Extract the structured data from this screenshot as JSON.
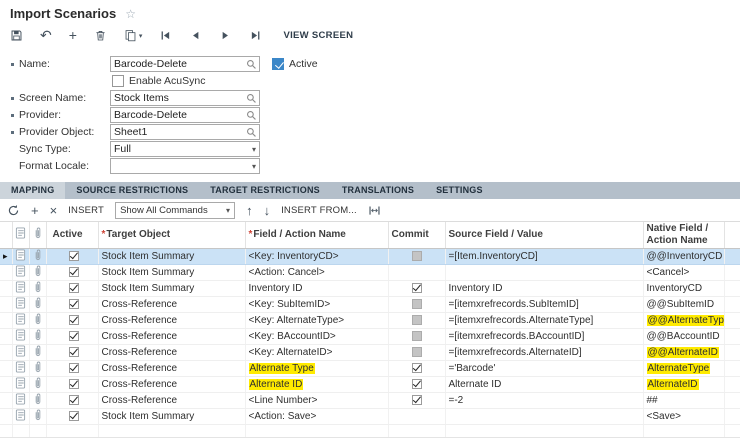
{
  "colors": {
    "highlight": "#ffeb00",
    "selected_row": "#cbe2f6",
    "tab_strip": "#b4bfca",
    "accent_blue": "#3b87c8"
  },
  "header": {
    "title": "Import Scenarios"
  },
  "toolbar": {
    "view_screen": "VIEW SCREEN"
  },
  "icons": {
    "favorite": "star-outline",
    "save": "floppy-disk",
    "undo": "undo-arrow",
    "add": "plus",
    "delete": "trash-can",
    "copy": "clipboard",
    "nav": [
      "first-record",
      "previous-record",
      "next-record",
      "last-record"
    ],
    "lookup": "magnifier",
    "dropdown": "caret-down",
    "grid": [
      "refresh",
      "plus",
      "x-delete",
      "arrow-up",
      "arrow-down",
      "fit-width",
      "note",
      "paperclip"
    ]
  },
  "form": {
    "name": {
      "label": "Name:",
      "value": "Barcode-Delete",
      "required": true
    },
    "active": {
      "label": "Active",
      "checked": true
    },
    "enable_acusync": {
      "label": "Enable AcuSync",
      "checked": false
    },
    "screen_name": {
      "label": "Screen Name:",
      "value": "Stock Items",
      "required": true
    },
    "provider": {
      "label": "Provider:",
      "value": "Barcode-Delete",
      "required": true
    },
    "provider_object": {
      "label": "Provider Object:",
      "value": "Sheet1",
      "required": true
    },
    "sync_type": {
      "label": "Sync Type:",
      "value": "Full"
    },
    "format_locale": {
      "label": "Format Locale:",
      "value": ""
    }
  },
  "tabs": [
    {
      "label": "MAPPING",
      "active": true
    },
    {
      "label": "SOURCE RESTRICTIONS"
    },
    {
      "label": "TARGET RESTRICTIONS"
    },
    {
      "label": "TRANSLATIONS"
    },
    {
      "label": "SETTINGS"
    }
  ],
  "grid_toolbar": {
    "insert": "INSERT",
    "commands": "Show All Commands",
    "insert_from": "INSERT FROM..."
  },
  "grid": {
    "columns": [
      {
        "key": "active",
        "label": "Active"
      },
      {
        "key": "target",
        "label": "Target Object",
        "required": true
      },
      {
        "key": "field",
        "label": "Field / Action Name",
        "required": true
      },
      {
        "key": "commit",
        "label": "Commit"
      },
      {
        "key": "source",
        "label": "Source Field / Value"
      },
      {
        "key": "native",
        "label": "Native Field / Action Name"
      }
    ],
    "rows": [
      {
        "selected": true,
        "active": true,
        "target": "Stock Item Summary",
        "field": "<Key: InventoryCD>",
        "commit": "disabled",
        "source": "=[Item.InventoryCD]",
        "native": "@@InventoryCD"
      },
      {
        "active": true,
        "target": "Stock Item Summary",
        "field": "<Action: Cancel>",
        "commit": "none",
        "source": "",
        "native": "<Cancel>"
      },
      {
        "active": true,
        "target": "Stock Item Summary",
        "field": "Inventory ID",
        "commit": "checked",
        "source": "Inventory ID",
        "native": "InventoryCD"
      },
      {
        "active": true,
        "target": "Cross-Reference",
        "field": "<Key: SubItemID>",
        "commit": "disabled",
        "source": "=[itemxrefrecords.SubItemID]",
        "native": "@@SubItemID"
      },
      {
        "active": true,
        "target": "Cross-Reference",
        "field": "<Key: AlternateType>",
        "commit": "disabled",
        "source": "=[itemxrefrecords.AlternateType]",
        "native": "@@AlternateType",
        "native_hl": true
      },
      {
        "active": true,
        "target": "Cross-Reference",
        "field": "<Key: BAccountID>",
        "commit": "disabled",
        "source": "=[itemxrefrecords.BAccountID]",
        "native": "@@BAccountID"
      },
      {
        "active": true,
        "target": "Cross-Reference",
        "field": "<Key: AlternateID>",
        "commit": "disabled",
        "source": "=[itemxrefrecords.AlternateID]",
        "native": "@@AlternateID",
        "native_hl": true
      },
      {
        "active": true,
        "target": "Cross-Reference",
        "field": "Alternate Type",
        "field_hl": true,
        "commit": "checked",
        "source": "='Barcode'",
        "native": "AlternateType",
        "native_hl": true
      },
      {
        "active": true,
        "target": "Cross-Reference",
        "field": "Alternate ID",
        "field_hl": true,
        "commit": "checked",
        "source": "Alternate ID",
        "native": "AlternateID",
        "native_hl": true
      },
      {
        "active": true,
        "target": "Cross-Reference",
        "field": "<Line Number>",
        "commit": "checked",
        "source": "=-2",
        "native": "##"
      },
      {
        "active": true,
        "target": "Stock Item Summary",
        "field": "<Action: Save>",
        "commit": "none",
        "source": "",
        "native": "<Save>"
      }
    ]
  }
}
